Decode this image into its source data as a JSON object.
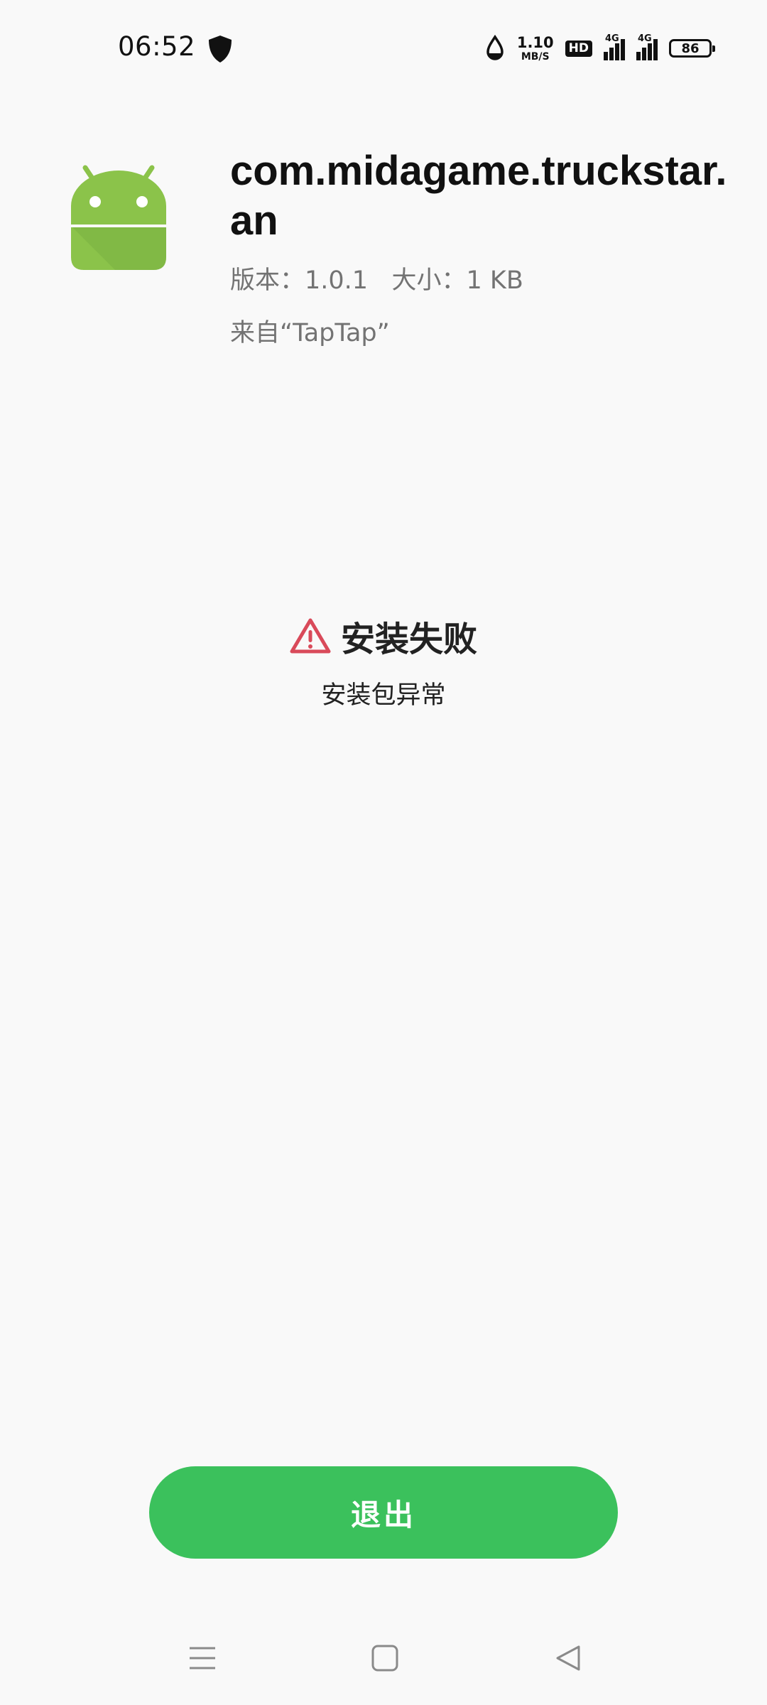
{
  "status_bar": {
    "time": "06:52",
    "net_speed_value": "1.10",
    "net_speed_unit": "MB/S",
    "hd_label": "HD",
    "signal1_label": "4G",
    "signal2_label": "4G",
    "battery_level": "86",
    "icons": [
      "shield-icon",
      "data-saver-icon",
      "hd-icon",
      "signal-icon",
      "signal-icon",
      "battery-icon"
    ]
  },
  "app": {
    "icon": "android-icon",
    "name": "com.midagame.truckstar.an",
    "version_label": "版本：",
    "version_value": "1.0.1",
    "size_label": "大小：",
    "size_value": "1 KB",
    "source": "来自“TapTap”"
  },
  "result": {
    "icon": "warning-icon",
    "title": "安装失败",
    "message": "安装包异常",
    "accent_color": "#d94a5a"
  },
  "actions": {
    "exit_label": "退出",
    "exit_color": "#3bc15c"
  },
  "nav": {
    "icons": [
      "menu-icon",
      "home-square-icon",
      "back-triangle-icon"
    ]
  }
}
